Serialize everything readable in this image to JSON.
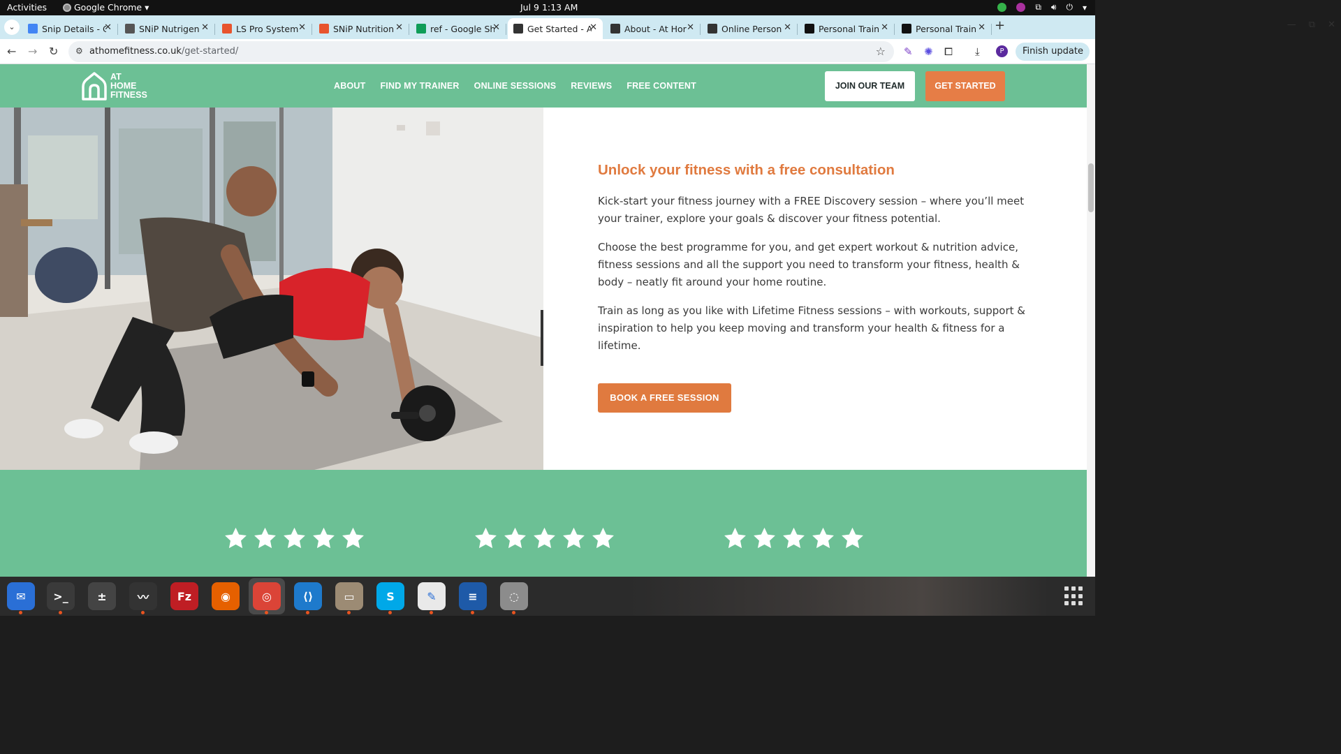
{
  "system": {
    "activities": "Activities",
    "app_name": "Google Chrome",
    "clock": "Jul 9  1:13 AM"
  },
  "browser": {
    "tabs": [
      {
        "label": "Snip Details - C",
        "icon": "google-docs-icon",
        "color": "#4285f4"
      },
      {
        "label": "SNiP Nutrigen",
        "icon": "snip-icon",
        "color": "#555555"
      },
      {
        "label": "LS Pro System",
        "icon": "ls-pro-icon",
        "color": "#e8542d"
      },
      {
        "label": "SNiP Nutrition",
        "icon": "snip-nutrition-icon",
        "color": "#e8542d"
      },
      {
        "label": "ref - Google Sh",
        "icon": "google-sheets-icon",
        "color": "#0f9d58"
      },
      {
        "label": "Get Started - A",
        "icon": "athome-icon",
        "color": "#333333",
        "active": true
      },
      {
        "label": "About - At Hor",
        "icon": "athome-icon",
        "color": "#333333"
      },
      {
        "label": "Online Person",
        "icon": "athome-icon",
        "color": "#333333"
      },
      {
        "label": "Personal Train",
        "icon": "fs-icon",
        "color": "#111111"
      },
      {
        "label": "Personal Train",
        "icon": "fs-icon",
        "color": "#111111"
      }
    ],
    "url_domain": "athomefitness.co.uk",
    "url_path": "/get-started/",
    "finish_update": "Finish update",
    "profile_initial": "P"
  },
  "site": {
    "logo_lines": [
      "AT",
      "HOME",
      "FITNESS"
    ],
    "nav": [
      "ABOUT",
      "FIND MY TRAINER",
      "ONLINE SESSIONS",
      "REVIEWS",
      "FREE CONTENT"
    ],
    "join_label": "JOIN OUR TEAM",
    "start_label": "GET STARTED",
    "colors": {
      "brand_green": "#6cc095",
      "accent_orange": "#e07a3f"
    }
  },
  "main": {
    "heading": "Unlock your fitness with a free consultation",
    "para1": "Kick-start your fitness journey with a FREE Discovery session – where you’ll meet your trainer, explore your goals & discover your fitness potential.",
    "para2": "Choose the best programme for you, and get expert workout & nutrition advice, fitness sessions and all the support you need to transform your fitness, health & body – neatly fit around your home routine.",
    "para3": "Train as long as you like with Lifetime Fitness sessions – with workouts, support & inspiration to help you keep moving and transform your health & fitness for a lifetime.",
    "cta_label": "BOOK A FREE SESSION"
  },
  "reviews": {
    "groups": [
      {
        "rating": 5
      },
      {
        "rating": 5
      },
      {
        "rating": 5
      }
    ]
  },
  "dock": {
    "apps": [
      "thunderbird-icon",
      "terminal-icon",
      "calculator-icon",
      "system-monitor-icon",
      "filezilla-icon",
      "firefox-icon",
      "chrome-icon",
      "vscode-icon",
      "files-icon",
      "skype-icon",
      "text-editor-icon",
      "writer-icon",
      "disk-icon"
    ]
  }
}
